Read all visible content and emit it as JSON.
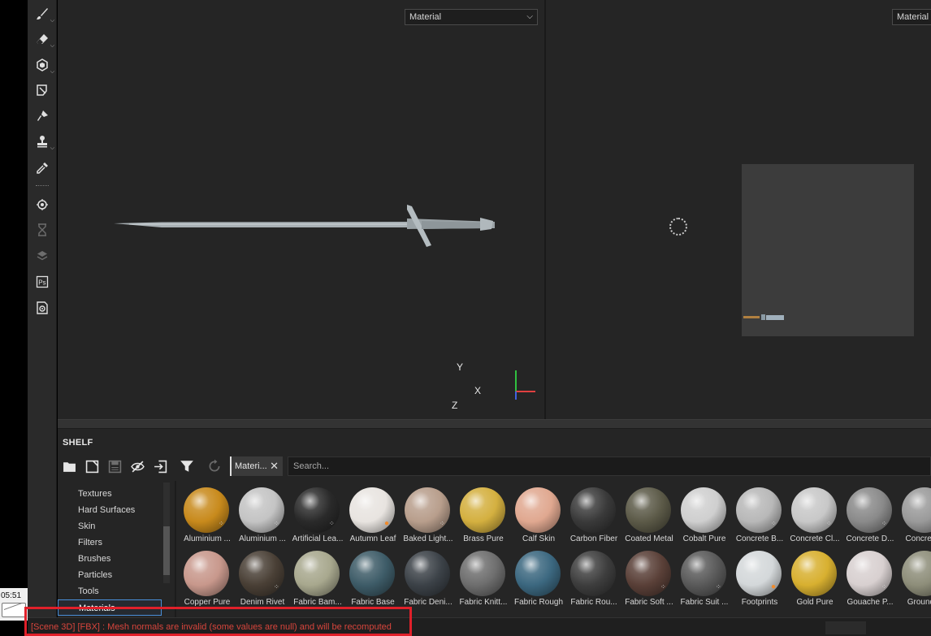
{
  "taskbar": {
    "time": "05:51"
  },
  "tools": [
    {
      "name": "paint-brush-icon",
      "dim": false,
      "submenu": true
    },
    {
      "name": "eraser-icon",
      "dim": false,
      "submenu": true
    },
    {
      "name": "projection-cube-icon",
      "dim": false,
      "submenu": true
    },
    {
      "name": "polygon-fill-icon",
      "dim": false,
      "submenu": false
    },
    {
      "name": "smudge-icon",
      "dim": false,
      "submenu": false
    },
    {
      "name": "clone-stamp-icon",
      "dim": false,
      "submenu": true
    },
    {
      "name": "color-picker-icon",
      "dim": false,
      "submenu": false
    },
    {
      "name": "physics-icon",
      "dim": false,
      "submenu": false
    },
    {
      "name": "timeline-icon",
      "dim": true,
      "submenu": false
    },
    {
      "name": "layer-stack-icon",
      "dim": true,
      "submenu": false
    },
    {
      "name": "photoshop-icon",
      "dim": false,
      "submenu": false
    },
    {
      "name": "screenshot-icon",
      "dim": false,
      "submenu": false
    }
  ],
  "viewport3d": {
    "mode": "Material",
    "axes": {
      "y": "Y",
      "x": "X",
      "z": "Z"
    }
  },
  "viewport2d": {
    "mode": "Material"
  },
  "shelf": {
    "title": "SHELF",
    "filter_tag": "Materi...",
    "search_placeholder": "Search...",
    "categories": [
      "Textures",
      "Hard Surfaces",
      "Skin",
      "Filters",
      "Brushes",
      "Particles",
      "Tools",
      "Materials"
    ],
    "selected_category": "Materials",
    "materials": [
      {
        "label": "Aluminium ...",
        "color": "#c88a1c",
        "badge": "dots"
      },
      {
        "label": "Aluminium ...",
        "color": "#c4c4c4",
        "badge": "dots"
      },
      {
        "label": "Artificial Lea...",
        "color": "#2a2a2a",
        "badge": "dots"
      },
      {
        "label": "Autumn Leaf",
        "color": "#e8e4e0",
        "badge": "orange"
      },
      {
        "label": "Baked Light...",
        "color": "#b89e8c",
        "badge": "dots"
      },
      {
        "label": "Brass Pure",
        "color": "#d4b040",
        "badge": ""
      },
      {
        "label": "Calf Skin",
        "color": "#e0a890",
        "badge": ""
      },
      {
        "label": "Carbon Fiber",
        "color": "#3a3a3a",
        "badge": ""
      },
      {
        "label": "Coated Metal",
        "color": "#5c5a48",
        "badge": ""
      },
      {
        "label": "Cobalt Pure",
        "color": "#cfcfcf",
        "badge": ""
      },
      {
        "label": "Concrete B...",
        "color": "#b8b8b8",
        "badge": "dots"
      },
      {
        "label": "Concrete Cl...",
        "color": "#c8c8c8",
        "badge": "dots"
      },
      {
        "label": "Concrete D...",
        "color": "#8a8a8a",
        "badge": "dots"
      },
      {
        "label": "Concrete...",
        "color": "#9a9a9a",
        "badge": ""
      },
      {
        "label": "Copper Pure",
        "color": "#c8988c",
        "badge": ""
      },
      {
        "label": "Denim Rivet",
        "color": "#4a4036",
        "badge": "dots"
      },
      {
        "label": "Fabric Bam...",
        "color": "#a8a88e",
        "badge": ""
      },
      {
        "label": "Fabric Base",
        "color": "#3e5c68",
        "badge": ""
      },
      {
        "label": "Fabric Deni...",
        "color": "#3c4248",
        "badge": ""
      },
      {
        "label": "Fabric Knitt...",
        "color": "#6e6e6e",
        "badge": ""
      },
      {
        "label": "Fabric Rough",
        "color": "#3c6880",
        "badge": ""
      },
      {
        "label": "Fabric Rou...",
        "color": "#3e3e3e",
        "badge": ""
      },
      {
        "label": "Fabric Soft ...",
        "color": "#5a4038",
        "badge": "dots"
      },
      {
        "label": "Fabric Suit ...",
        "color": "#5a5a5a",
        "badge": "dots"
      },
      {
        "label": "Footprints",
        "color": "#d4d8da",
        "badge": "orange"
      },
      {
        "label": "Gold Pure",
        "color": "#d8b030",
        "badge": ""
      },
      {
        "label": "Gouache P...",
        "color": "#d8d0d0",
        "badge": "dots"
      },
      {
        "label": "Ground ...",
        "color": "#8e8e7a",
        "badge": ""
      }
    ]
  },
  "status": {
    "message": "[Scene 3D] [FBX] : Mesh normals are invalid (some values are null) and will be recomputed",
    "color": "#d8453c"
  }
}
